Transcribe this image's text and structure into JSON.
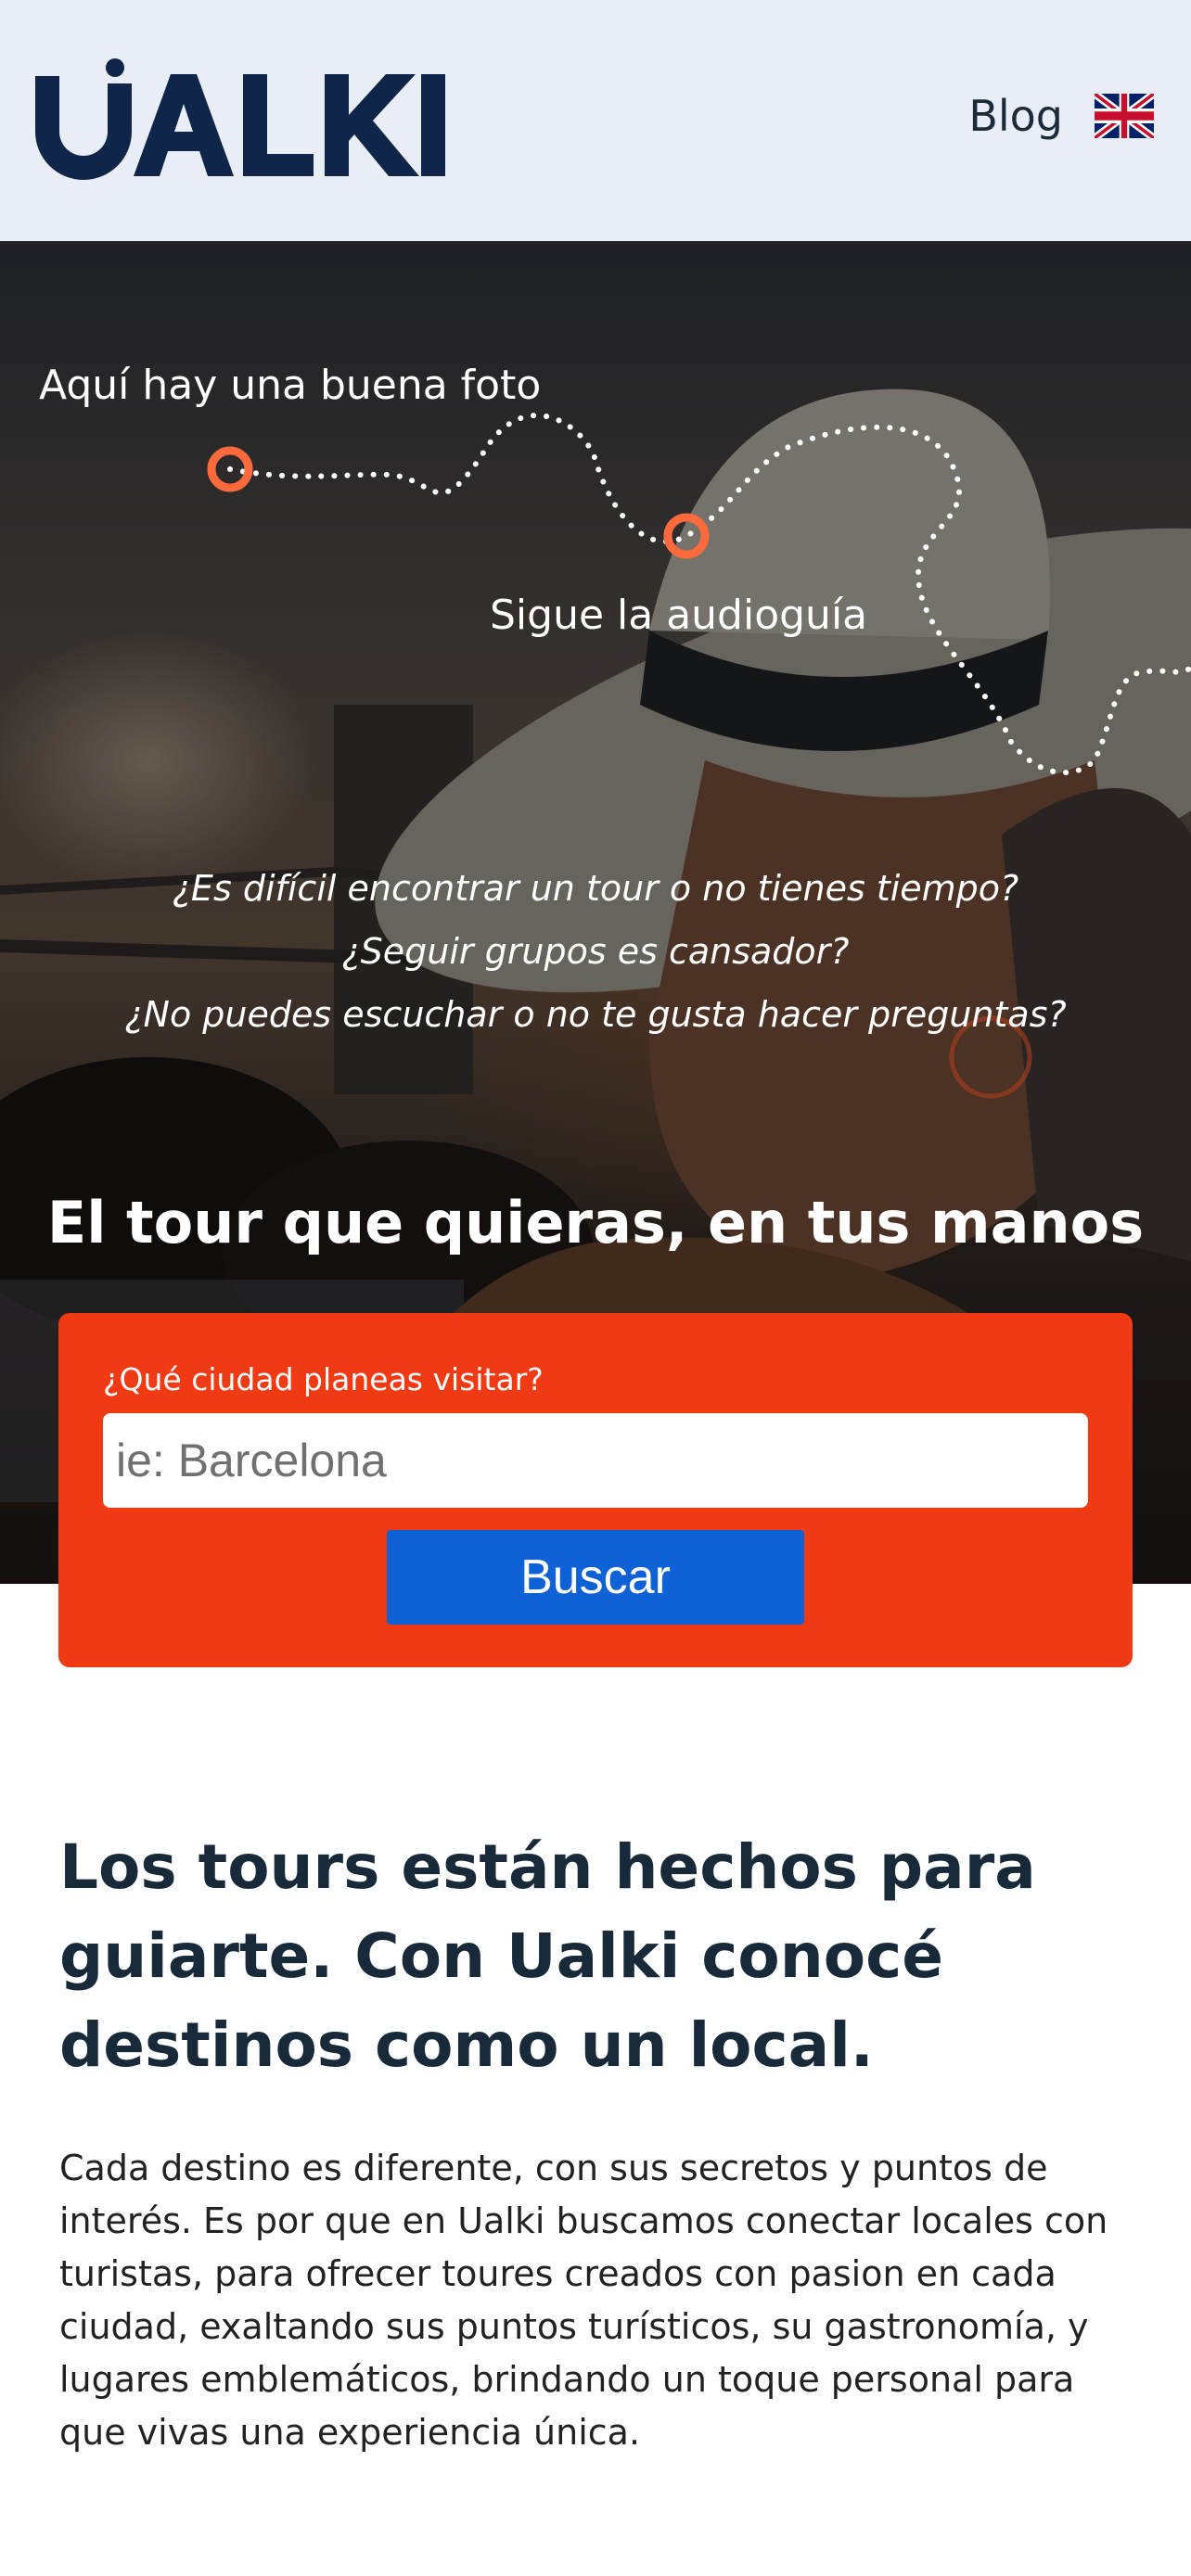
{
  "header": {
    "logo_text": "UALKI",
    "blog_label": "Blog",
    "language_icon": "uk-flag-icon"
  },
  "hero": {
    "tip_photo": "Aquí hay una buena foto",
    "tip_audio": "Sigue la audioguía",
    "questions": [
      "¿Es difícil encontrar un tour o no tienes tiempo?",
      "¿Seguir grupos es cansador?",
      "¿No puedes escuchar o no te gusta hacer preguntas?"
    ],
    "headline": "El tour que quieras, en tus manos"
  },
  "search": {
    "label": "¿Qué ciudad planeas visitar?",
    "placeholder": "ie: Barcelona",
    "value": "",
    "button_label": "Buscar"
  },
  "intro": {
    "title": "Los tours están hechos para guiarte. Con Ualki conocé destinos como un local.",
    "text": "Cada destino es diferente, con sus secretos y puntos de interés. Es por que en Ualki buscamos conectar locales con turistas, para ofrecer toures creados con pasion en cada ciudad, exaltando sus puntos turísticos, su gastronomía, y lugares emblemáticos, brindando un toque personal para que vivas una experiencia única."
  },
  "colors": {
    "header_bg": "#e9eef6",
    "brand_navy": "#10254a",
    "accent_orange": "#f03a14",
    "button_blue": "#0f62d6",
    "marker_orange": "#ff6a3d"
  }
}
